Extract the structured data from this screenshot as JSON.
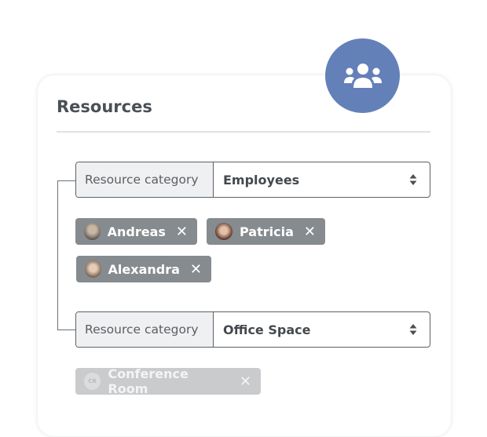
{
  "header": {
    "title": "Resources",
    "badge_icon": "users-icon",
    "badge_color": "#6480b8"
  },
  "groups": [
    {
      "label": "Resource category",
      "value": "Employees",
      "tags": [
        {
          "name": "Andreas",
          "avatar": "photo"
        },
        {
          "name": "Patricia",
          "avatar": "photo"
        },
        {
          "name": "Alexandra",
          "avatar": "photo"
        }
      ]
    },
    {
      "label": "Resource category",
      "value": "Office Space",
      "tags": [
        {
          "name": "Conference Room",
          "avatar": "CR",
          "disabled": true
        }
      ]
    }
  ],
  "remove_glyph": "✕"
}
